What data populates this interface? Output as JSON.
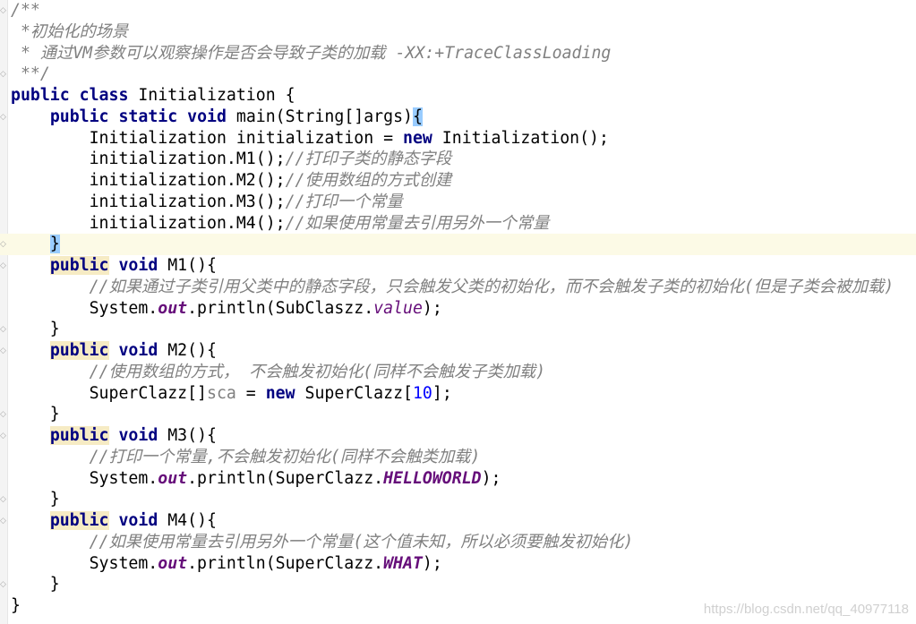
{
  "editor": {
    "lines": [
      {
        "tokens": [
          [
            "c",
            "/**"
          ]
        ]
      },
      {
        "tokens": [
          [
            "c",
            " *初始化的场景"
          ]
        ]
      },
      {
        "tokens": [
          [
            "c",
            " * 通过VM参数可以观察操作是否会导致子类的加载 -XX:+TraceClassLoading"
          ]
        ]
      },
      {
        "tokens": [
          [
            "c",
            " **/"
          ]
        ]
      },
      {
        "tokens": [
          [
            "k",
            "public"
          ],
          [
            "p",
            " "
          ],
          [
            "k",
            "class"
          ],
          [
            "p",
            " Initialization {"
          ]
        ]
      },
      {
        "tokens": [
          [
            "p",
            "    "
          ],
          [
            "k",
            "public"
          ],
          [
            "p",
            " "
          ],
          [
            "k",
            "static"
          ],
          [
            "p",
            " "
          ],
          [
            "k",
            "void"
          ],
          [
            "p",
            " main(String[]args)"
          ],
          [
            "b",
            "{"
          ]
        ]
      },
      {
        "tokens": [
          [
            "p",
            "        Initialization initialization = "
          ],
          [
            "k",
            "new"
          ],
          [
            "p",
            " Initialization();"
          ]
        ]
      },
      {
        "tokens": [
          [
            "p",
            "        initialization.M1();"
          ],
          [
            "c",
            "//打印子类的静态字段"
          ]
        ]
      },
      {
        "tokens": [
          [
            "p",
            "        initialization.M2();"
          ],
          [
            "c",
            "//使用数组的方式创建"
          ]
        ]
      },
      {
        "tokens": [
          [
            "p",
            "        initialization.M3();"
          ],
          [
            "c",
            "//打印一个常量"
          ]
        ]
      },
      {
        "tokens": [
          [
            "p",
            "        initialization.M4();"
          ],
          [
            "c",
            "//如果使用常量去引用另外一个常量"
          ]
        ]
      },
      {
        "current": true,
        "tokens": [
          [
            "p",
            "    "
          ],
          [
            "b",
            "}"
          ]
        ]
      },
      {
        "tokens": [
          [
            "p",
            "    "
          ],
          [
            "kh",
            "public"
          ],
          [
            "p",
            " "
          ],
          [
            "k",
            "void"
          ],
          [
            "p",
            " M1(){"
          ]
        ]
      },
      {
        "tokens": [
          [
            "p",
            "        "
          ],
          [
            "c",
            "//如果通过子类引用父类中的静态字段，只会触发父类的初始化，而不会触发子类的初始化(但是子类会被加载)"
          ]
        ]
      },
      {
        "tokens": [
          [
            "p",
            "        System."
          ],
          [
            "f",
            "out"
          ],
          [
            "p",
            ".println(SubClaszz."
          ],
          [
            "v",
            "value"
          ],
          [
            "p",
            ");"
          ]
        ]
      },
      {
        "tokens": [
          [
            "p",
            "    }"
          ]
        ]
      },
      {
        "tokens": [
          [
            "p",
            "    "
          ],
          [
            "kh",
            "public"
          ],
          [
            "p",
            " "
          ],
          [
            "k",
            "void"
          ],
          [
            "p",
            " M2(){"
          ]
        ]
      },
      {
        "tokens": [
          [
            "p",
            "        "
          ],
          [
            "c",
            "//使用数组的方式， 不会触发初始化(同样不会触发子类加载)"
          ]
        ]
      },
      {
        "tokens": [
          [
            "p",
            "        SuperClazz[]"
          ],
          [
            "g",
            "sca"
          ],
          [
            "p",
            " = "
          ],
          [
            "k",
            "new"
          ],
          [
            "p",
            " SuperClazz["
          ],
          [
            "n",
            "10"
          ],
          [
            "p",
            "];"
          ]
        ]
      },
      {
        "tokens": [
          [
            "p",
            "    }"
          ]
        ]
      },
      {
        "tokens": [
          [
            "p",
            "    "
          ],
          [
            "kh",
            "public"
          ],
          [
            "p",
            " "
          ],
          [
            "k",
            "void"
          ],
          [
            "p",
            " M3(){"
          ]
        ]
      },
      {
        "tokens": [
          [
            "p",
            "        "
          ],
          [
            "c",
            "//打印一个常量,不会触发初始化(同样不会触类加载)"
          ]
        ]
      },
      {
        "tokens": [
          [
            "p",
            "        System."
          ],
          [
            "f",
            "out"
          ],
          [
            "p",
            ".println(SuperClazz."
          ],
          [
            "f",
            "HELLOWORLD"
          ],
          [
            "p",
            ");"
          ]
        ]
      },
      {
        "tokens": [
          [
            "p",
            "    }"
          ]
        ]
      },
      {
        "tokens": [
          [
            "p",
            "    "
          ],
          [
            "kh",
            "public"
          ],
          [
            "p",
            " "
          ],
          [
            "k",
            "void"
          ],
          [
            "p",
            " M4(){"
          ]
        ]
      },
      {
        "tokens": [
          [
            "p",
            "        "
          ],
          [
            "c",
            "//如果使用常量去引用另外一个常量(这个值未知，所以必须要触发初始化)"
          ]
        ]
      },
      {
        "tokens": [
          [
            "p",
            "        System."
          ],
          [
            "f",
            "out"
          ],
          [
            "p",
            ".println(SuperClazz."
          ],
          [
            "f",
            "WHAT"
          ],
          [
            "p",
            ");"
          ]
        ]
      },
      {
        "tokens": [
          [
            "p",
            "    }"
          ]
        ]
      },
      {
        "tokens": [
          [
            "p",
            "}"
          ]
        ]
      }
    ]
  },
  "watermark": "https://blog.csdn.net/qq_40977118",
  "colors": {
    "keyword": "#000080",
    "comment": "#808080",
    "field": "#660e7a",
    "number": "#0000ff",
    "brace_match": "#99ccff",
    "current_line": "#fcfae6"
  }
}
